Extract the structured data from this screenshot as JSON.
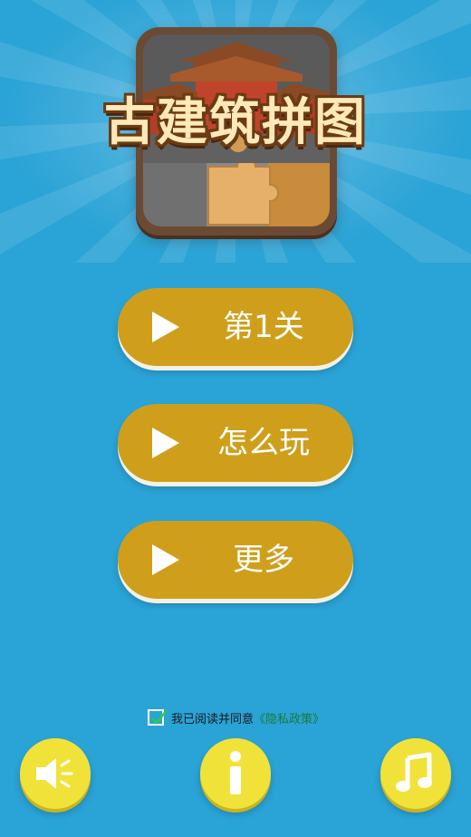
{
  "logo": {
    "title": "古建筑拼图",
    "picture": "ancient-building-jigsaw-logo"
  },
  "menu": [
    {
      "label": "第1关",
      "icon": "play-icon"
    },
    {
      "label": "怎么玩",
      "icon": "play-icon"
    },
    {
      "label": "更多",
      "icon": "play-icon"
    }
  ],
  "agreement": {
    "checked": true,
    "text": "我已阅读并同意",
    "policy_link": "《隐私政策》"
  },
  "bottom_buttons": [
    {
      "icon": "speaker-icon"
    },
    {
      "icon": "info-icon"
    },
    {
      "icon": "music-note-icon"
    }
  ],
  "colors": {
    "background": "#2aa3d6",
    "button": "#cf9f1b",
    "round_button": "#f1e23a",
    "policy_link": "#1a7a38"
  }
}
